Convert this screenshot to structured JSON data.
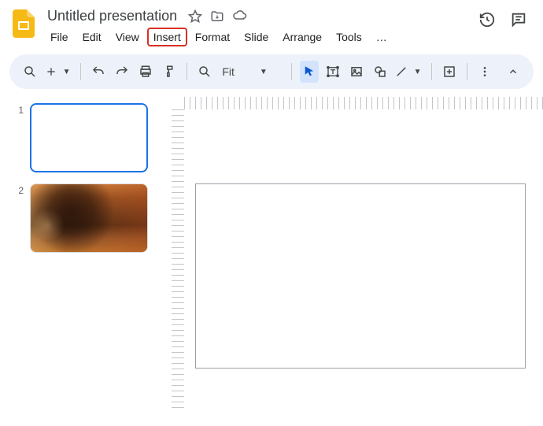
{
  "doc": {
    "title": "Untitled presentation"
  },
  "menu": {
    "file": "File",
    "edit": "Edit",
    "view": "View",
    "insert": "Insert",
    "format": "Format",
    "slide": "Slide",
    "arrange": "Arrange",
    "tools": "Tools",
    "more": "…"
  },
  "toolbar": {
    "fit_label": "Fit"
  },
  "slides": {
    "s1": "1",
    "s2": "2"
  }
}
